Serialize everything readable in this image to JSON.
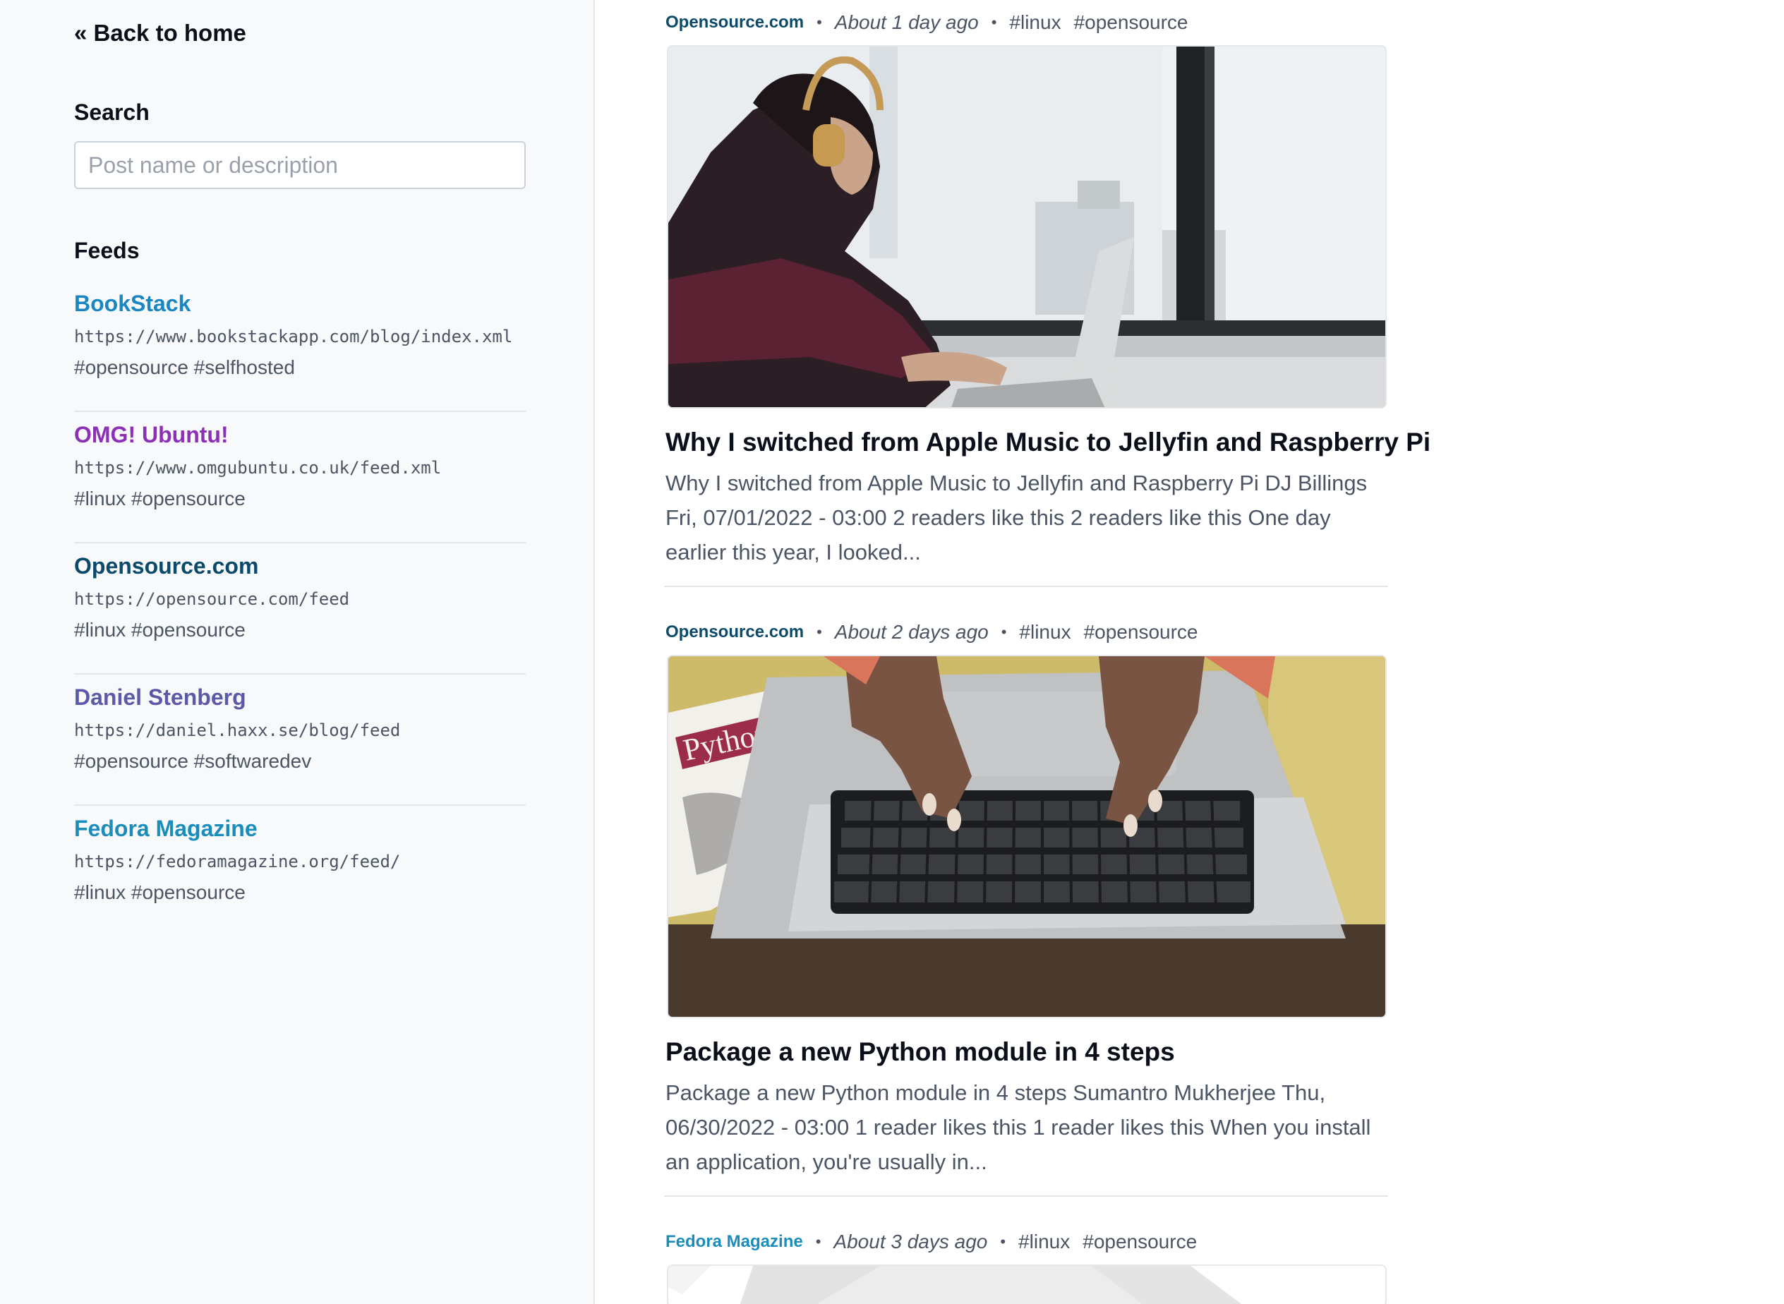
{
  "sidebar": {
    "back_label": "« Back to home",
    "search_title": "Search",
    "search_placeholder": "Post name or description",
    "feeds_title": "Feeds",
    "feeds": [
      {
        "name": "BookStack",
        "url": "https://www.bookstackapp.com/blog/index.xml",
        "tags": "#opensource #selfhosted",
        "color": "#1a86c2"
      },
      {
        "name": "OMG! Ubuntu!",
        "url": "https://www.omgubuntu.co.uk/feed.xml",
        "tags": "#linux #opensource",
        "color": "#8b31b5"
      },
      {
        "name": "Opensource.com",
        "url": "https://opensource.com/feed",
        "tags": "#linux #opensource",
        "color": "#0b4a6b"
      },
      {
        "name": "Daniel Stenberg",
        "url": "https://daniel.haxx.se/blog/feed",
        "tags": "#opensource #softwaredev",
        "color": "#5c5aa6"
      },
      {
        "name": "Fedora Magazine",
        "url": "https://fedoramagazine.org/feed/",
        "tags": "#linux #opensource",
        "color": "#1b8dbb"
      }
    ]
  },
  "posts": [
    {
      "source": "Opensource.com",
      "source_color": "#0b4a6b",
      "date": "About 1 day ago",
      "tags": [
        "#linux",
        "#opensource"
      ],
      "title": "Why I switched from Apple Music to Jellyfin and Raspberry Pi",
      "description": "Why I switched from Apple Music to Jellyfin and Raspberry Pi DJ Billings Fri, 07/01/2022 - 03:00 2 readers like this 2 readers like this One day earlier this year, I looked..."
    },
    {
      "source": "Opensource.com",
      "source_color": "#0b4a6b",
      "date": "About 2 days ago",
      "tags": [
        "#linux",
        "#opensource"
      ],
      "title": "Package a new Python module in 4 steps",
      "description": "Package a new Python module in 4 steps Sumantro Mukherjee Thu, 06/30/2022 - 03:00 1 reader likes this 1 reader likes this When you install an application, you're usually in...",
      "image_text": "Python"
    },
    {
      "source": "Fedora Magazine",
      "source_color": "#1b8dbb",
      "date": "About 3 days ago",
      "tags": [
        "#linux",
        "#opensource"
      ]
    }
  ],
  "meta_separator": "•"
}
